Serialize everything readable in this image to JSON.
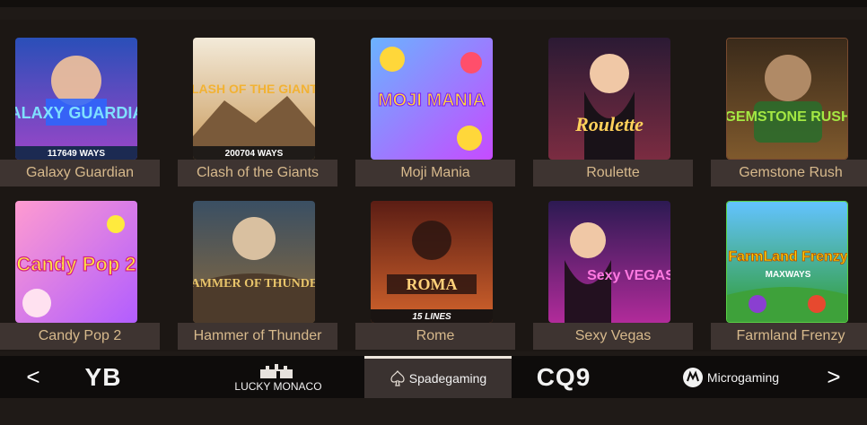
{
  "games": [
    {
      "title": "Galaxy Guardian",
      "art": "GALAXY GUARDIAN",
      "ways": "117649 WAYS",
      "bg1": "#2a4fb8",
      "bg2": "#9b46c8",
      "text": "#7fe0ff"
    },
    {
      "title": "Clash of the Giants",
      "art": "CLASH OF THE GIANTS",
      "ways": "200704 WAYS",
      "bg1": "#f3ead9",
      "bg2": "#c99a5b",
      "text": "#f2b233"
    },
    {
      "title": "Moji Mania",
      "art": "MOJI MANIA",
      "bg1": "#6ab3ff",
      "bg2": "#c64bff",
      "text": "#ffd73a"
    },
    {
      "title": "Roulette",
      "art": "Roulette",
      "bg1": "#2b1a34",
      "bg2": "#7b2c41",
      "text": "#ffd15b"
    },
    {
      "title": "Gemstone Rush",
      "art": "GEMSTONE RUSH",
      "bg1": "#3a2a1a",
      "bg2": "#805a2d",
      "text": "#a4e843"
    },
    {
      "title": "Candy Pop 2",
      "art": "Candy Pop 2",
      "bg1": "#ff9bd0",
      "bg2": "#b15dff",
      "text": "#ffea3d"
    },
    {
      "title": "Hammer of Thunder",
      "art": "HAMMER OF THUNDER",
      "bg1": "#3a4f63",
      "bg2": "#8a6a3d",
      "text": "#e8c46a"
    },
    {
      "title": "Rome",
      "art": "ROMA",
      "lines": "15 LINES",
      "bg1": "#5b1d14",
      "bg2": "#d2632c",
      "text": "#ffd17a"
    },
    {
      "title": "Sexy Vegas",
      "art": "Sexy VEGAS",
      "bg1": "#2c1a52",
      "bg2": "#b12b9a",
      "text": "#ff7ae1"
    },
    {
      "title": "Farmland Frenzy",
      "art": "FarmLand Frenzy",
      "sub": "MAXWAYS",
      "bg1": "#63c3ff",
      "bg2": "#2f9b2c",
      "text": "#ffd200"
    }
  ],
  "providers": {
    "prev": "<",
    "next": ">",
    "yb": "YB",
    "lucky_monaco": "LUCKY MONACO",
    "spadegaming": "Spadegaming",
    "cq9": "CQ9",
    "microgaming": "Microgaming"
  }
}
